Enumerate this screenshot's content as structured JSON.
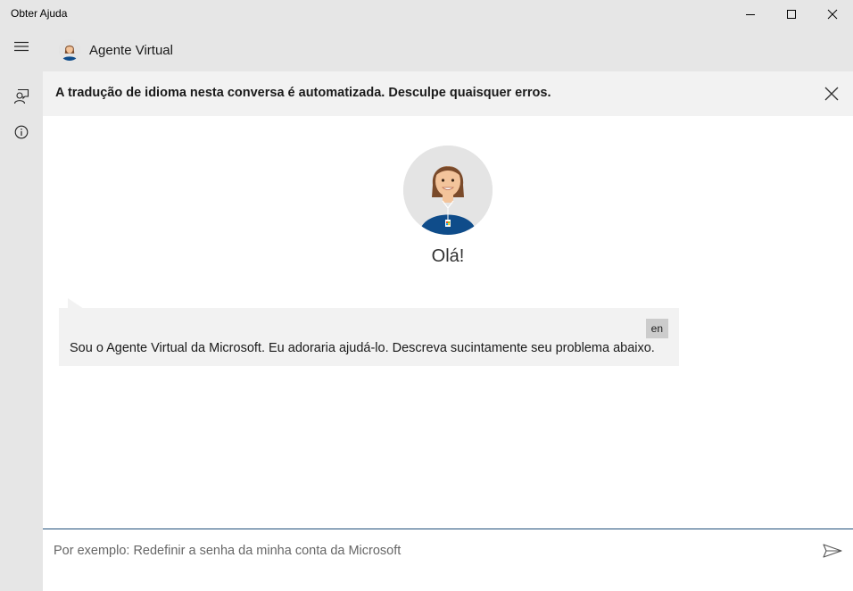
{
  "window": {
    "title": "Obter Ajuda"
  },
  "header": {
    "agent_name": "Agente Virtual"
  },
  "banner": {
    "text": "A tradução de idioma nesta conversa é automatizada. Desculpe quaisquer erros."
  },
  "greeting": "Olá!",
  "message": {
    "lang_badge": "en",
    "text": "Sou o Agente Virtual da Microsoft. Eu adoraria ajudá-lo. Descreva sucintamente seu problema abaixo."
  },
  "composer": {
    "value": "",
    "placeholder": "Por exemplo: Redefinir a senha da minha conta da Microsoft"
  },
  "icons": [
    "minimize-icon",
    "maximize-icon",
    "close-icon",
    "hamburger-menu-icon",
    "chat-agent-icon",
    "info-icon",
    "dismiss-icon",
    "send-icon"
  ],
  "colors": {
    "chrome": "#e6e6e6",
    "banner": "#f2f2f2",
    "accent_line": "#1f4e79",
    "badge": "#cccccc",
    "shirt": "#0f4c8a"
  }
}
